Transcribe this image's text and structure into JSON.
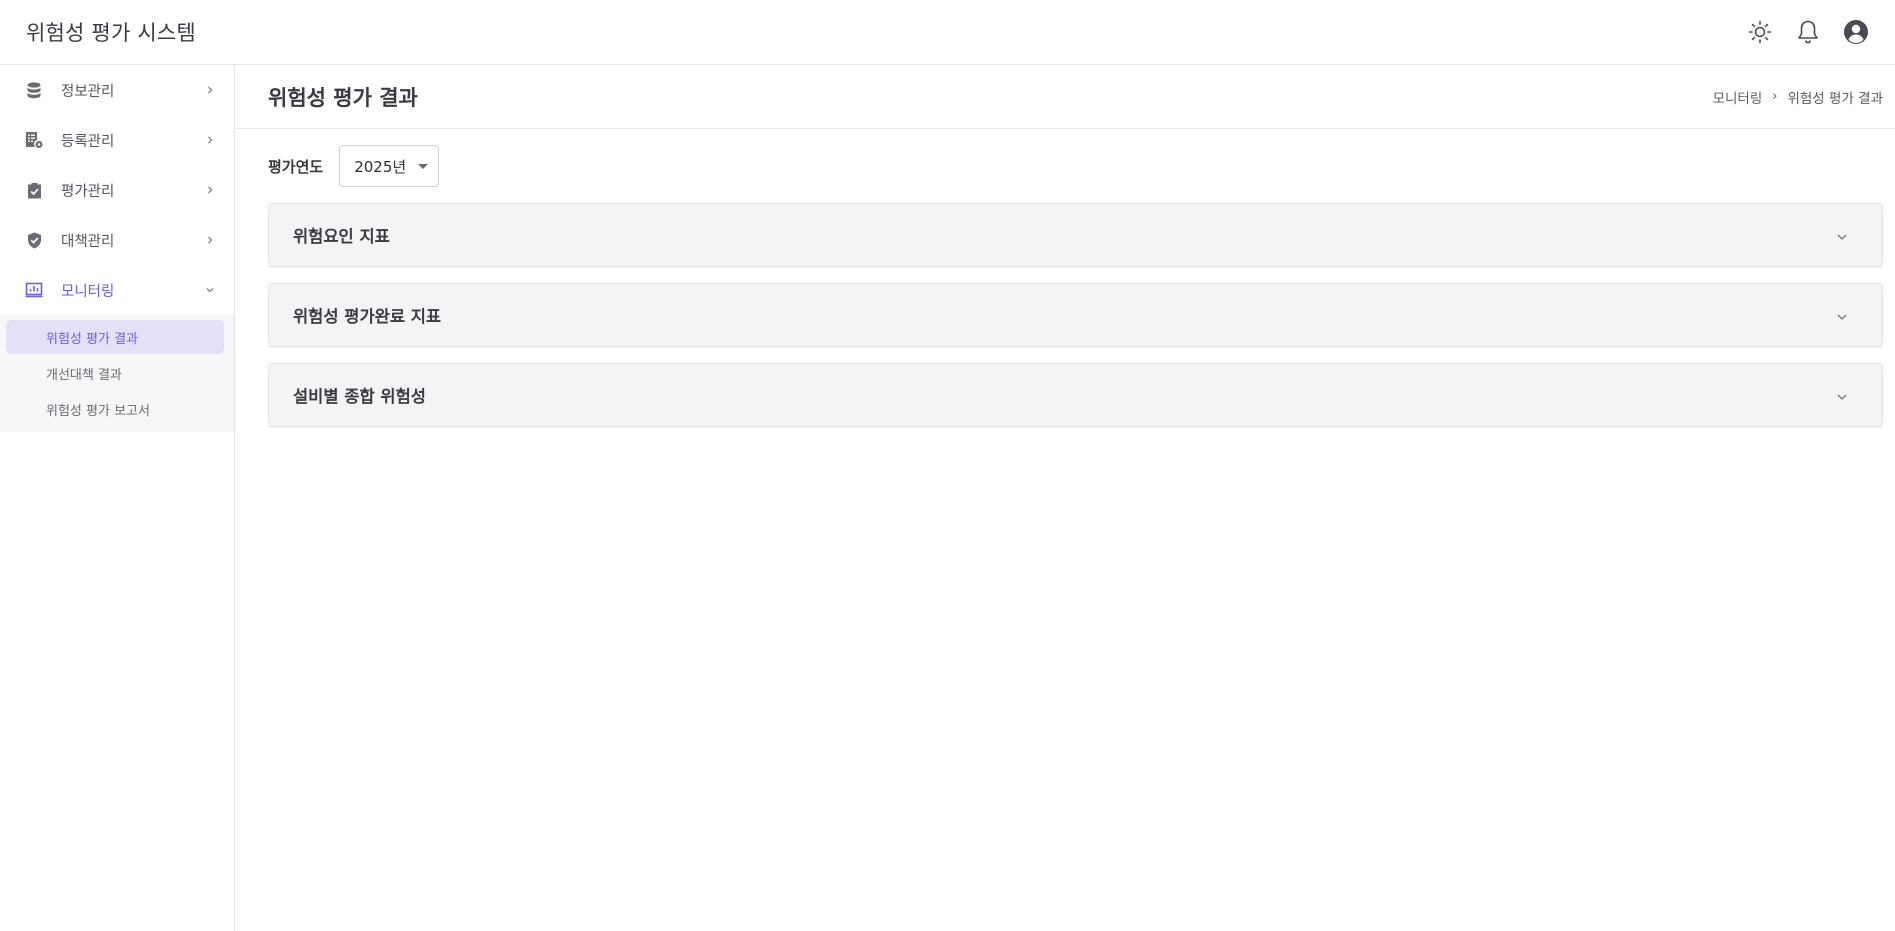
{
  "app": {
    "title": "위험성 평가 시스템"
  },
  "header_icons": [
    {
      "name": "sun-icon"
    },
    {
      "name": "bell-icon"
    },
    {
      "name": "user-icon"
    }
  ],
  "sidebar": {
    "items": [
      {
        "label": "정보관리",
        "icon": "database-icon"
      },
      {
        "label": "등록관리",
        "icon": "register-icon"
      },
      {
        "label": "평가관리",
        "icon": "clipboard-icon"
      },
      {
        "label": "대책관리",
        "icon": "shield-icon"
      },
      {
        "label": "모니터링",
        "icon": "chart-icon"
      }
    ],
    "submenu": [
      {
        "label": "위험성 평가 결과"
      },
      {
        "label": "개선대책 결과"
      },
      {
        "label": "위험성 평가 보고서"
      }
    ]
  },
  "main": {
    "title": "위험성 평가 결과",
    "breadcrumb": {
      "parent": "모니터링",
      "separator": "›",
      "current": "위험성 평가 결과"
    },
    "filter": {
      "label": "평가연도",
      "year": "2025년"
    },
    "accordions": [
      {
        "title": "위험요인 지표"
      },
      {
        "title": "위험성 평가완료 지표"
      },
      {
        "title": "설비별 종합 위험성"
      }
    ]
  },
  "colors": {
    "accent": "#6e5ce6",
    "selected_bg": "#e3e0f7",
    "icon_gray": "#6b6b73"
  }
}
